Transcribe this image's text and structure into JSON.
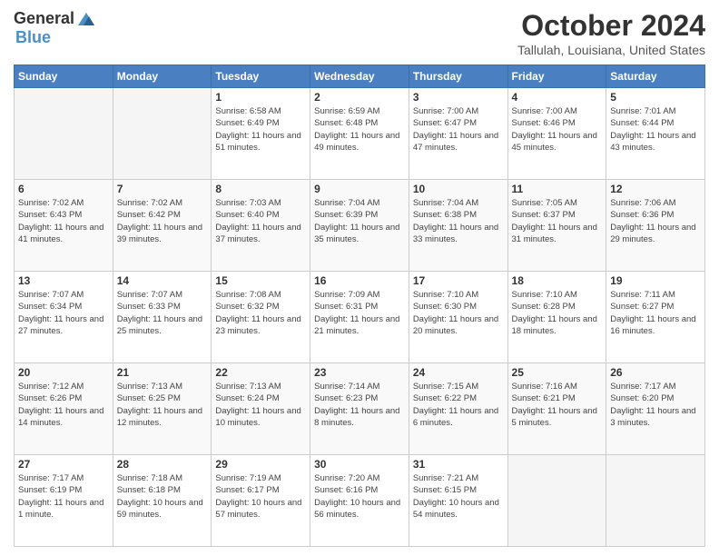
{
  "logo": {
    "general": "General",
    "blue": "Blue"
  },
  "header": {
    "month": "October 2024",
    "location": "Tallulah, Louisiana, United States"
  },
  "weekdays": [
    "Sunday",
    "Monday",
    "Tuesday",
    "Wednesday",
    "Thursday",
    "Friday",
    "Saturday"
  ],
  "weeks": [
    [
      {
        "day": "",
        "sunrise": "",
        "sunset": "",
        "daylight": ""
      },
      {
        "day": "",
        "sunrise": "",
        "sunset": "",
        "daylight": ""
      },
      {
        "day": "1",
        "sunrise": "Sunrise: 6:58 AM",
        "sunset": "Sunset: 6:49 PM",
        "daylight": "Daylight: 11 hours and 51 minutes."
      },
      {
        "day": "2",
        "sunrise": "Sunrise: 6:59 AM",
        "sunset": "Sunset: 6:48 PM",
        "daylight": "Daylight: 11 hours and 49 minutes."
      },
      {
        "day": "3",
        "sunrise": "Sunrise: 7:00 AM",
        "sunset": "Sunset: 6:47 PM",
        "daylight": "Daylight: 11 hours and 47 minutes."
      },
      {
        "day": "4",
        "sunrise": "Sunrise: 7:00 AM",
        "sunset": "Sunset: 6:46 PM",
        "daylight": "Daylight: 11 hours and 45 minutes."
      },
      {
        "day": "5",
        "sunrise": "Sunrise: 7:01 AM",
        "sunset": "Sunset: 6:44 PM",
        "daylight": "Daylight: 11 hours and 43 minutes."
      }
    ],
    [
      {
        "day": "6",
        "sunrise": "Sunrise: 7:02 AM",
        "sunset": "Sunset: 6:43 PM",
        "daylight": "Daylight: 11 hours and 41 minutes."
      },
      {
        "day": "7",
        "sunrise": "Sunrise: 7:02 AM",
        "sunset": "Sunset: 6:42 PM",
        "daylight": "Daylight: 11 hours and 39 minutes."
      },
      {
        "day": "8",
        "sunrise": "Sunrise: 7:03 AM",
        "sunset": "Sunset: 6:40 PM",
        "daylight": "Daylight: 11 hours and 37 minutes."
      },
      {
        "day": "9",
        "sunrise": "Sunrise: 7:04 AM",
        "sunset": "Sunset: 6:39 PM",
        "daylight": "Daylight: 11 hours and 35 minutes."
      },
      {
        "day": "10",
        "sunrise": "Sunrise: 7:04 AM",
        "sunset": "Sunset: 6:38 PM",
        "daylight": "Daylight: 11 hours and 33 minutes."
      },
      {
        "day": "11",
        "sunrise": "Sunrise: 7:05 AM",
        "sunset": "Sunset: 6:37 PM",
        "daylight": "Daylight: 11 hours and 31 minutes."
      },
      {
        "day": "12",
        "sunrise": "Sunrise: 7:06 AM",
        "sunset": "Sunset: 6:36 PM",
        "daylight": "Daylight: 11 hours and 29 minutes."
      }
    ],
    [
      {
        "day": "13",
        "sunrise": "Sunrise: 7:07 AM",
        "sunset": "Sunset: 6:34 PM",
        "daylight": "Daylight: 11 hours and 27 minutes."
      },
      {
        "day": "14",
        "sunrise": "Sunrise: 7:07 AM",
        "sunset": "Sunset: 6:33 PM",
        "daylight": "Daylight: 11 hours and 25 minutes."
      },
      {
        "day": "15",
        "sunrise": "Sunrise: 7:08 AM",
        "sunset": "Sunset: 6:32 PM",
        "daylight": "Daylight: 11 hours and 23 minutes."
      },
      {
        "day": "16",
        "sunrise": "Sunrise: 7:09 AM",
        "sunset": "Sunset: 6:31 PM",
        "daylight": "Daylight: 11 hours and 21 minutes."
      },
      {
        "day": "17",
        "sunrise": "Sunrise: 7:10 AM",
        "sunset": "Sunset: 6:30 PM",
        "daylight": "Daylight: 11 hours and 20 minutes."
      },
      {
        "day": "18",
        "sunrise": "Sunrise: 7:10 AM",
        "sunset": "Sunset: 6:28 PM",
        "daylight": "Daylight: 11 hours and 18 minutes."
      },
      {
        "day": "19",
        "sunrise": "Sunrise: 7:11 AM",
        "sunset": "Sunset: 6:27 PM",
        "daylight": "Daylight: 11 hours and 16 minutes."
      }
    ],
    [
      {
        "day": "20",
        "sunrise": "Sunrise: 7:12 AM",
        "sunset": "Sunset: 6:26 PM",
        "daylight": "Daylight: 11 hours and 14 minutes."
      },
      {
        "day": "21",
        "sunrise": "Sunrise: 7:13 AM",
        "sunset": "Sunset: 6:25 PM",
        "daylight": "Daylight: 11 hours and 12 minutes."
      },
      {
        "day": "22",
        "sunrise": "Sunrise: 7:13 AM",
        "sunset": "Sunset: 6:24 PM",
        "daylight": "Daylight: 11 hours and 10 minutes."
      },
      {
        "day": "23",
        "sunrise": "Sunrise: 7:14 AM",
        "sunset": "Sunset: 6:23 PM",
        "daylight": "Daylight: 11 hours and 8 minutes."
      },
      {
        "day": "24",
        "sunrise": "Sunrise: 7:15 AM",
        "sunset": "Sunset: 6:22 PM",
        "daylight": "Daylight: 11 hours and 6 minutes."
      },
      {
        "day": "25",
        "sunrise": "Sunrise: 7:16 AM",
        "sunset": "Sunset: 6:21 PM",
        "daylight": "Daylight: 11 hours and 5 minutes."
      },
      {
        "day": "26",
        "sunrise": "Sunrise: 7:17 AM",
        "sunset": "Sunset: 6:20 PM",
        "daylight": "Daylight: 11 hours and 3 minutes."
      }
    ],
    [
      {
        "day": "27",
        "sunrise": "Sunrise: 7:17 AM",
        "sunset": "Sunset: 6:19 PM",
        "daylight": "Daylight: 11 hours and 1 minute."
      },
      {
        "day": "28",
        "sunrise": "Sunrise: 7:18 AM",
        "sunset": "Sunset: 6:18 PM",
        "daylight": "Daylight: 10 hours and 59 minutes."
      },
      {
        "day": "29",
        "sunrise": "Sunrise: 7:19 AM",
        "sunset": "Sunset: 6:17 PM",
        "daylight": "Daylight: 10 hours and 57 minutes."
      },
      {
        "day": "30",
        "sunrise": "Sunrise: 7:20 AM",
        "sunset": "Sunset: 6:16 PM",
        "daylight": "Daylight: 10 hours and 56 minutes."
      },
      {
        "day": "31",
        "sunrise": "Sunrise: 7:21 AM",
        "sunset": "Sunset: 6:15 PM",
        "daylight": "Daylight: 10 hours and 54 minutes."
      },
      {
        "day": "",
        "sunrise": "",
        "sunset": "",
        "daylight": ""
      },
      {
        "day": "",
        "sunrise": "",
        "sunset": "",
        "daylight": ""
      }
    ]
  ]
}
